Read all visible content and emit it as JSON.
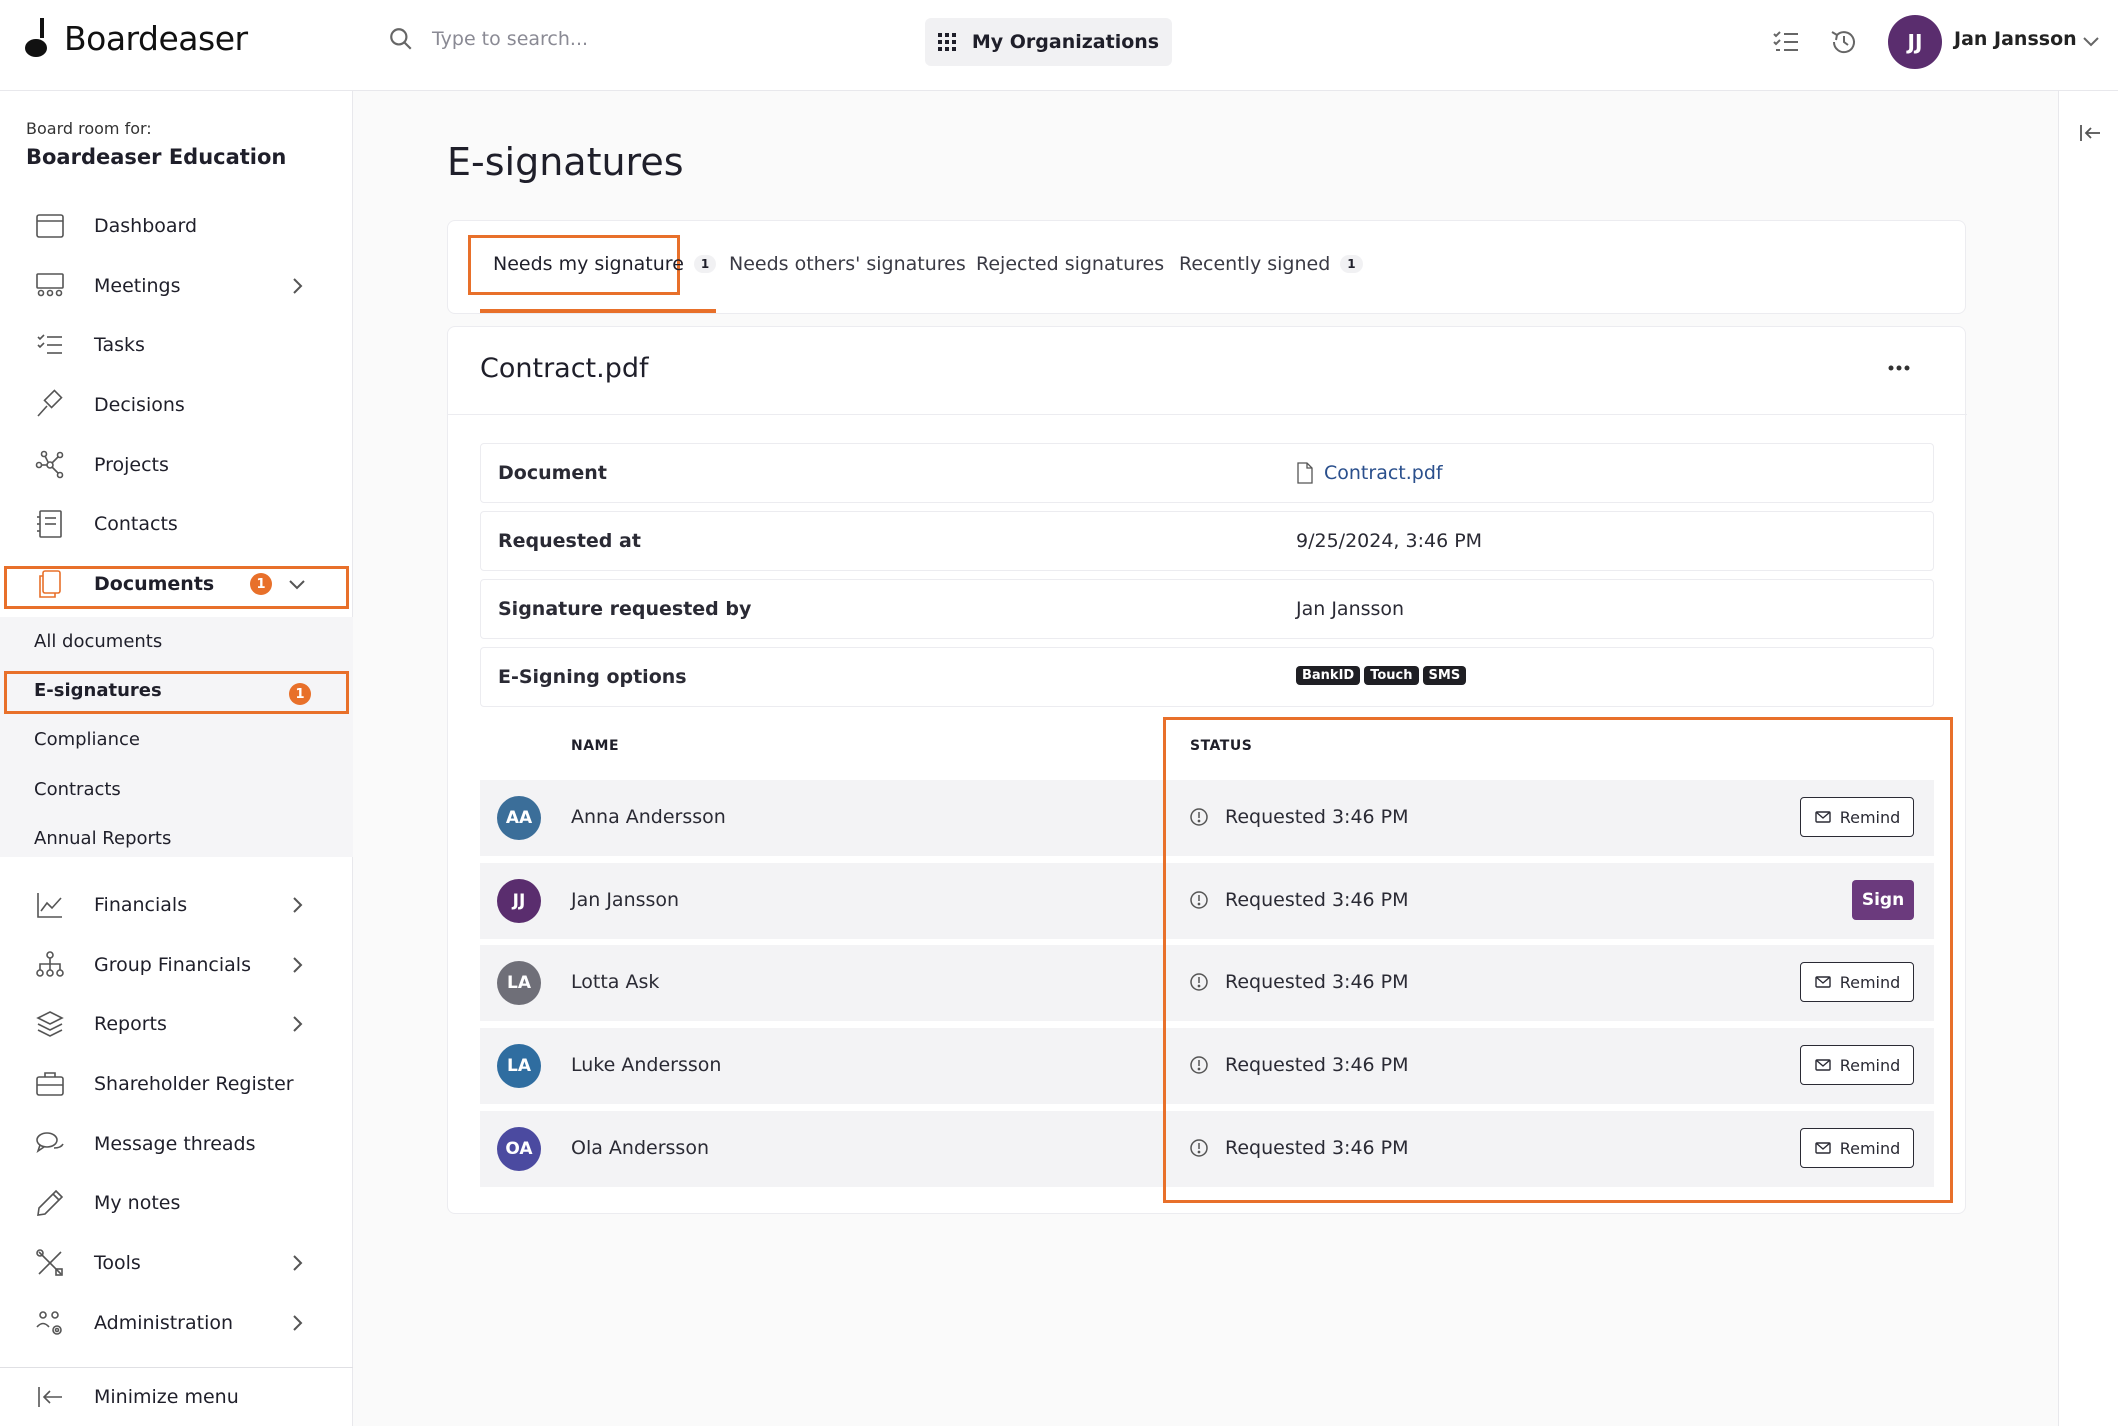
{
  "app": {
    "logo_text": "Boardeaser",
    "search_placeholder": "Type to search...",
    "org_button": "My Organizations",
    "user": {
      "initials": "JJ",
      "name": "Jan Jansson"
    }
  },
  "sidebar": {
    "board_for_label": "Board room for:",
    "board_name": "Boardeaser Education",
    "items": [
      {
        "label": "Dashboard",
        "icon": "calendar-icon"
      },
      {
        "label": "Meetings",
        "icon": "meeting-icon"
      },
      {
        "label": "Tasks",
        "icon": "tasks-icon"
      },
      {
        "label": "Decisions",
        "icon": "gavel-icon"
      },
      {
        "label": "Projects",
        "icon": "projects-icon"
      },
      {
        "label": "Contacts",
        "icon": "contacts-icon"
      },
      {
        "label": "Documents",
        "icon": "documents-icon",
        "badge": "1"
      },
      {
        "label": "Financials",
        "icon": "chart-icon"
      },
      {
        "label": "Group Financials",
        "icon": "hierarchy-icon"
      },
      {
        "label": "Reports",
        "icon": "layers-icon"
      },
      {
        "label": "Shareholder Register",
        "icon": "briefcase-icon"
      },
      {
        "label": "Message threads",
        "icon": "chat-icon"
      },
      {
        "label": "My notes",
        "icon": "pencil-icon"
      },
      {
        "label": "Tools",
        "icon": "tools-icon"
      },
      {
        "label": "Administration",
        "icon": "admin-icon"
      }
    ],
    "documents_sub": [
      {
        "label": "All documents"
      },
      {
        "label": "E-signatures",
        "badge": "1"
      },
      {
        "label": "Compliance"
      },
      {
        "label": "Contracts"
      },
      {
        "label": "Annual Reports"
      }
    ],
    "minimize_label": "Minimize menu"
  },
  "main": {
    "title": "E-signatures",
    "tabs": [
      {
        "label": "Needs my signature",
        "count": "1"
      },
      {
        "label": "Needs others' signatures"
      },
      {
        "label": "Rejected signatures"
      },
      {
        "label": "Recently signed",
        "count": "1"
      }
    ],
    "document": {
      "title": "Contract.pdf",
      "rows": [
        {
          "key": "Document",
          "value": "Contract.pdf"
        },
        {
          "key": "Requested at",
          "value": "9/25/2024, 3:46 PM"
        },
        {
          "key": "Signature requested by",
          "value": "Jan Jansson"
        },
        {
          "key": "E-Signing options",
          "pills": [
            "BankID",
            "Touch",
            "SMS"
          ]
        }
      ],
      "columns": {
        "name": "NAME",
        "status": "STATUS"
      },
      "signers": [
        {
          "initials": "AA",
          "name": "Anna Andersson",
          "status": "Requested 3:46 PM",
          "action": "Remind",
          "color": "#3b6e99"
        },
        {
          "initials": "JJ",
          "name": "Jan Jansson",
          "status": "Requested 3:46 PM",
          "action": "Sign",
          "color": "#5a2d6e"
        },
        {
          "initials": "LA",
          "name": "Lotta Ask",
          "status": "Requested 3:46 PM",
          "action": "Remind",
          "color": "#6f6f78"
        },
        {
          "initials": "LA",
          "name": "Luke Andersson",
          "status": "Requested 3:46 PM",
          "action": "Remind",
          "color": "#2f6da0"
        },
        {
          "initials": "OA",
          "name": "Ola Andersson",
          "status": "Requested 3:46 PM",
          "action": "Remind",
          "color": "#4b4aa0"
        }
      ]
    }
  },
  "colors": {
    "accent": "#e8702a",
    "primary": "#5a2d6e",
    "sign_button": "#6b3a7d"
  }
}
